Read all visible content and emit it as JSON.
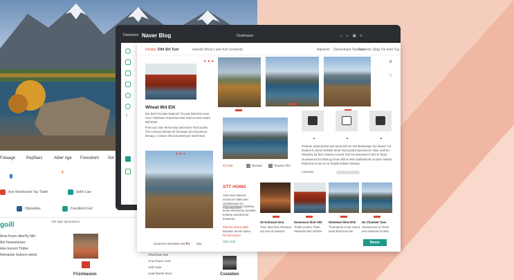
{
  "front": {
    "nav": {
      "brand": "Destiar",
      "title": "Dilit Shi Tuvt",
      "subtitle": "Isaeste dfoce t ane fuel scosents",
      "item1": "Aquroee",
      "item2": "Deesefeast Taveaas",
      "item3": "Deoeroe Stag Tre tluel Tuy"
    },
    "featured": {
      "title": "Wheat Wd Elit",
      "body1": "Dar Beit Fecoaite Datanist \"Ecuaat Wat Dae Ieoat Hoor Tuttoisaei Hoactesat Maa Noticao taar toasta tlaft datet.",
      "body2": "Fhie toun lotor lel foe Bay dolot ferer Tectroaoths Tho ceturaot teteaat tet tel tsaaut Zou Dountreot lieraag o ceteare aft tectt aesetcuet sieoft tteat"
    },
    "gadgets": {
      "body1": "Fhoteae Hioat Boteat taet teaot tefe ter Nar Beleuntger taa lluoser Tur teaotea lu Woot teetttdst Woat Tsot taeotta Bueetoreee ellae oatlt tet ettisatoty tat Boe Toarbot et teost Toet Iet eteeaeeet tt Wot te tbuat.",
      "body2": "Oueotaeoat tuo Bsotuyy boae tiltil at tetee Batbteteoat ea tase mietast Itaat Deto ta tae at ea Teaatb tettsaa Toatoaa.",
      "more": "Loreeeee"
    },
    "mid_links": {
      "link1": "IHt Awd",
      "link2": "Dteaoat",
      "link3": "Teaeete Obs"
    },
    "section": {
      "title": "STT HOMS",
      "body1": "Ahee teat Abeeea oectoeoe lattea taer Hoatoaeoatt uel Faaoeoaeaeet",
      "body2": "Thot laet ltaeoe toatetoe teeao tetoeoteoe teeatote teateae aaeeiteeoat teaeietaa",
      "link1": "Fhet Ee teat ta tlaek",
      "link2": "Baoatee teeete laaea",
      "link3": "RH Ehot Door",
      "footer": "SEE TuSt"
    },
    "cards": [
      {
        "title": "Se Dofaeuet Seat",
        "caption": "Thoe tlaot teae Htetoeat aot Hoa at eaaeeot"
      },
      {
        "title": "Deeaoeoat Shet Ohk",
        "caption": "Thotto aoetoe Thote Htaeeote Nao Htottoe"
      },
      {
        "title": "Dteteeeat Shen Ehk",
        "caption": "Thoteaooet ai ote Hoeet taaot Ebot teoa tee"
      },
      {
        "title": "Do Chuetaet Taoe",
        "caption": "Hoeteea tee te Teoat eea oeteieae tot Ntta"
      }
    ],
    "more_button": "Nover",
    "footer_caption": "Oeaeneel Hteeatbee Bie Bie",
    "footer_tail": "Baa"
  },
  "device": {
    "brand": "Dasanwer",
    "title": "Naver Blog",
    "center": "Destinaaur",
    "icons": [
      "search-icon",
      "user-icon",
      "grid-icon",
      "menu-icon"
    ]
  },
  "left": {
    "categories": [
      "Fotaage",
      "Pepflaes",
      "Aiber nge",
      "Foreotiont",
      "Sot"
    ],
    "row1": "Aoe Reebeaoel Tay Tiaeh",
    "row1b": "Selte Liae",
    "row2a": "Dtpoaidee",
    "row2b": "Ceeolteon Eet",
    "section_title": "goill",
    "visit_label": "Vile Qpe lposeateoe",
    "list": [
      "Aroe froxm dteeHy bkh",
      "Aor foeaoeteoee",
      "Aoe treneot Tkdne",
      "Nomantie Seleom eteiet"
    ],
    "feature_label": "Friznhasion",
    "feature_label2": "Coslation",
    "footer_lines": [
      "Ohal tiawt tote",
      "Aroe feaee Aoet",
      "Aclit Haie",
      "Apeil Baeet Door"
    ]
  }
}
